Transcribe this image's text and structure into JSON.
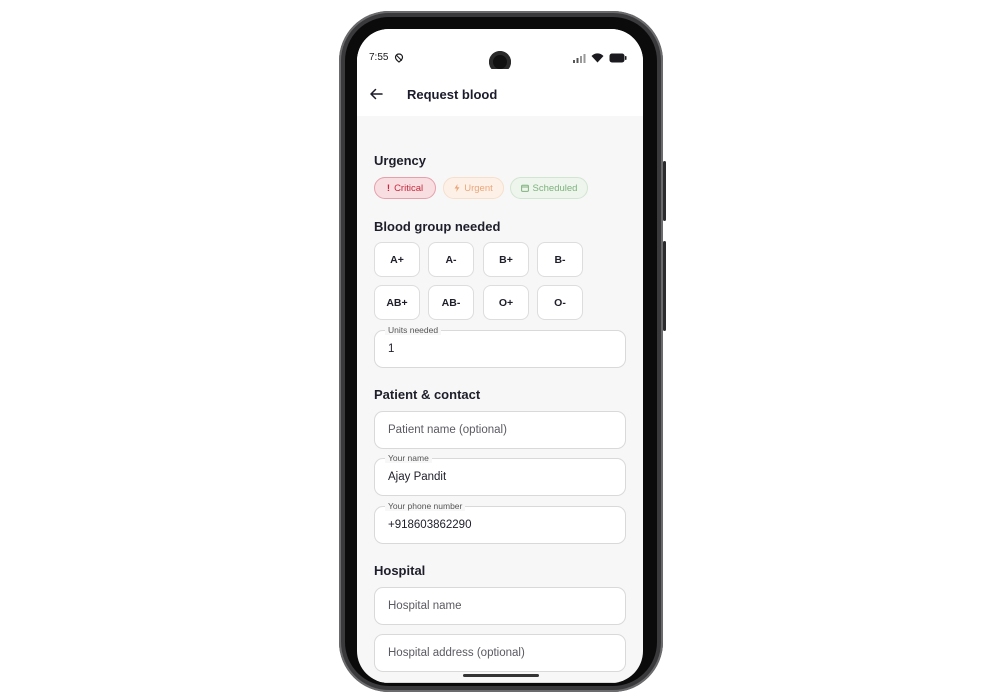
{
  "status_bar": {
    "time": "7:55"
  },
  "app_bar": {
    "title": "Request blood"
  },
  "urgency": {
    "title": "Urgency",
    "options": [
      {
        "label": "Critical",
        "icon": "exclamation-icon",
        "color": "#c62a3d"
      },
      {
        "label": "Urgent",
        "icon": "bolt-icon",
        "color": "#eba67b"
      },
      {
        "label": "Scheduled",
        "icon": "calendar-icon",
        "color": "#7fb27d"
      }
    ]
  },
  "blood_group": {
    "title": "Blood group needed",
    "options": [
      "A+",
      "A-",
      "B+",
      "B-",
      "AB+",
      "AB-",
      "O+",
      "O-"
    ]
  },
  "units": {
    "label": "Units needed",
    "value": "1"
  },
  "patient_contact": {
    "title": "Patient & contact",
    "patient_name": {
      "placeholder": "Patient name (optional)"
    },
    "your_name": {
      "label": "Your name",
      "value": "Ajay Pandit"
    },
    "phone": {
      "label": "Your phone number",
      "value": "+918603862290"
    }
  },
  "hospital": {
    "title": "Hospital",
    "name": {
      "placeholder": "Hospital name"
    },
    "address": {
      "placeholder": "Hospital address (optional)"
    }
  }
}
